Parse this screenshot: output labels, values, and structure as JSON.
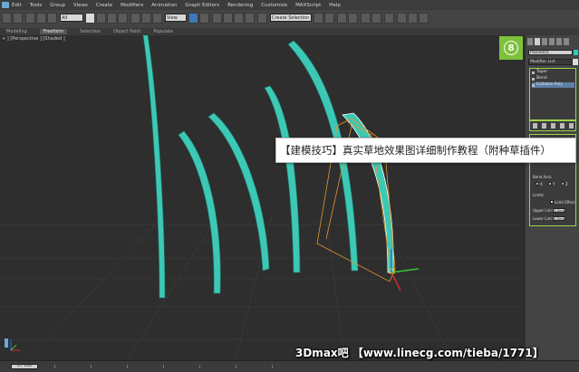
{
  "menu": [
    "Edit",
    "Tools",
    "Group",
    "Views",
    "Create",
    "Modifiers",
    "Animation",
    "Graph Editors",
    "Rendering",
    "Customize",
    "MAXScript",
    "Help"
  ],
  "toolbar": {
    "selection_filter": "All",
    "view_dropdown": "View",
    "named_selection_placeholder": "Create Selection Se"
  },
  "ribbon": {
    "tabs": [
      "Modeling",
      "Freeform",
      "Selection",
      "Object Paint",
      "Populate"
    ],
    "active": "Freeform"
  },
  "viewport": {
    "label": "+ ] [Perspective ] [Shaded ]"
  },
  "command_panel": {
    "badge": "8",
    "object_name": "Plane001",
    "object_color": "#2ec9b8",
    "modifier_list_label": "Modifier List",
    "stack": [
      "Taper",
      "Bend",
      "Editable Poly"
    ],
    "selected_stack_index": 2,
    "params": {
      "bend_axis_label": "Bend Axis:",
      "axes": [
        "X",
        "Y",
        "Z"
      ],
      "limits_label": "Limits",
      "limit_effect_label": "Limit Effect",
      "upper_limit_label": "Upper Limit:",
      "upper_limit_value": "0.0mm",
      "lower_limit_label": "Lower Limit:",
      "lower_limit_value": "0.0mm"
    }
  },
  "caption": "【建模技巧】真实草地效果图详细制作教程（附种草插件）",
  "status": {
    "frame": "0 / 100"
  },
  "watermark": "3Dmax吧 【www.linecg.com/tieba/1771】",
  "colors": {
    "grass_blade": "#3cc8b4",
    "accent_green": "#7ec13c",
    "selection_blue": "#3e78b8"
  }
}
